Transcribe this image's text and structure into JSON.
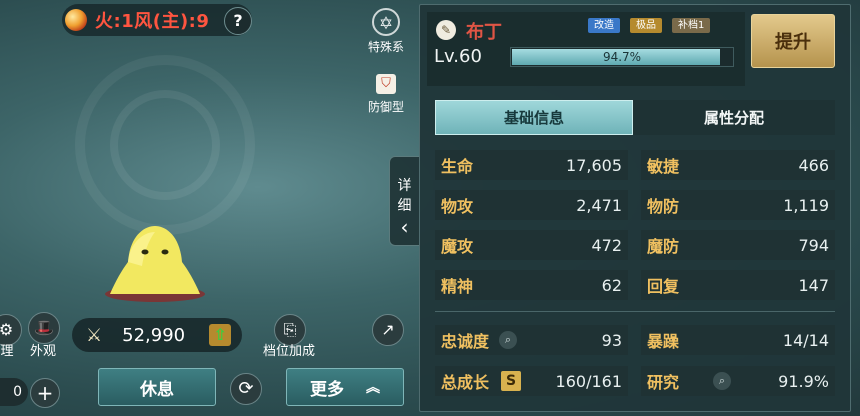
{
  "pet": {
    "element_text": "火:1风(主):9",
    "help": "?",
    "badges": {
      "type_label": "特殊系",
      "role_label": "防御型"
    },
    "detail_tab": [
      "详",
      "细",
      "‹"
    ]
  },
  "bottom_left": {
    "partial_label": "理",
    "appearance_label": "外观",
    "power_value": "52,990",
    "slot_bonus_label": "档位加成",
    "left_partial_value": "0",
    "plus": "+",
    "rest_button": "休息",
    "more_button": "更多",
    "more_arrow": "︽"
  },
  "panel": {
    "name": "布丁",
    "tags": [
      {
        "label": "改造",
        "color": "#3a78c8"
      },
      {
        "label": "极品",
        "color": "#b58a2e"
      },
      {
        "label": "补档1",
        "color": "#7a6a4a"
      }
    ],
    "level": "Lv.60",
    "exp_percent_text": "94.7%",
    "exp_fraction": 0.947,
    "upgrade_button": "提升",
    "tabs": {
      "basic": "基础信息",
      "attributes": "属性分配"
    },
    "stats_left": [
      {
        "label": "生命",
        "value": "17,605"
      },
      {
        "label": "物攻",
        "value": "2,471"
      },
      {
        "label": "魔攻",
        "value": "472"
      },
      {
        "label": "精神",
        "value": "62"
      }
    ],
    "stats_right": [
      {
        "label": "敏捷",
        "value": "466"
      },
      {
        "label": "物防",
        "value": "1,119"
      },
      {
        "label": "魔防",
        "value": "794"
      },
      {
        "label": "回复",
        "value": "147"
      }
    ],
    "loyalty": {
      "label": "忠诚度",
      "value": "93"
    },
    "temper": {
      "label": "暴躁",
      "value": "14/14"
    },
    "growth": {
      "label": "总成长",
      "grade": "S",
      "value": "160/161"
    },
    "research": {
      "label": "研究",
      "value": "91.9%"
    }
  },
  "colors": {
    "accent_gold": "#f0c060",
    "element_red": "#ff5540",
    "name_red": "#e05545"
  }
}
